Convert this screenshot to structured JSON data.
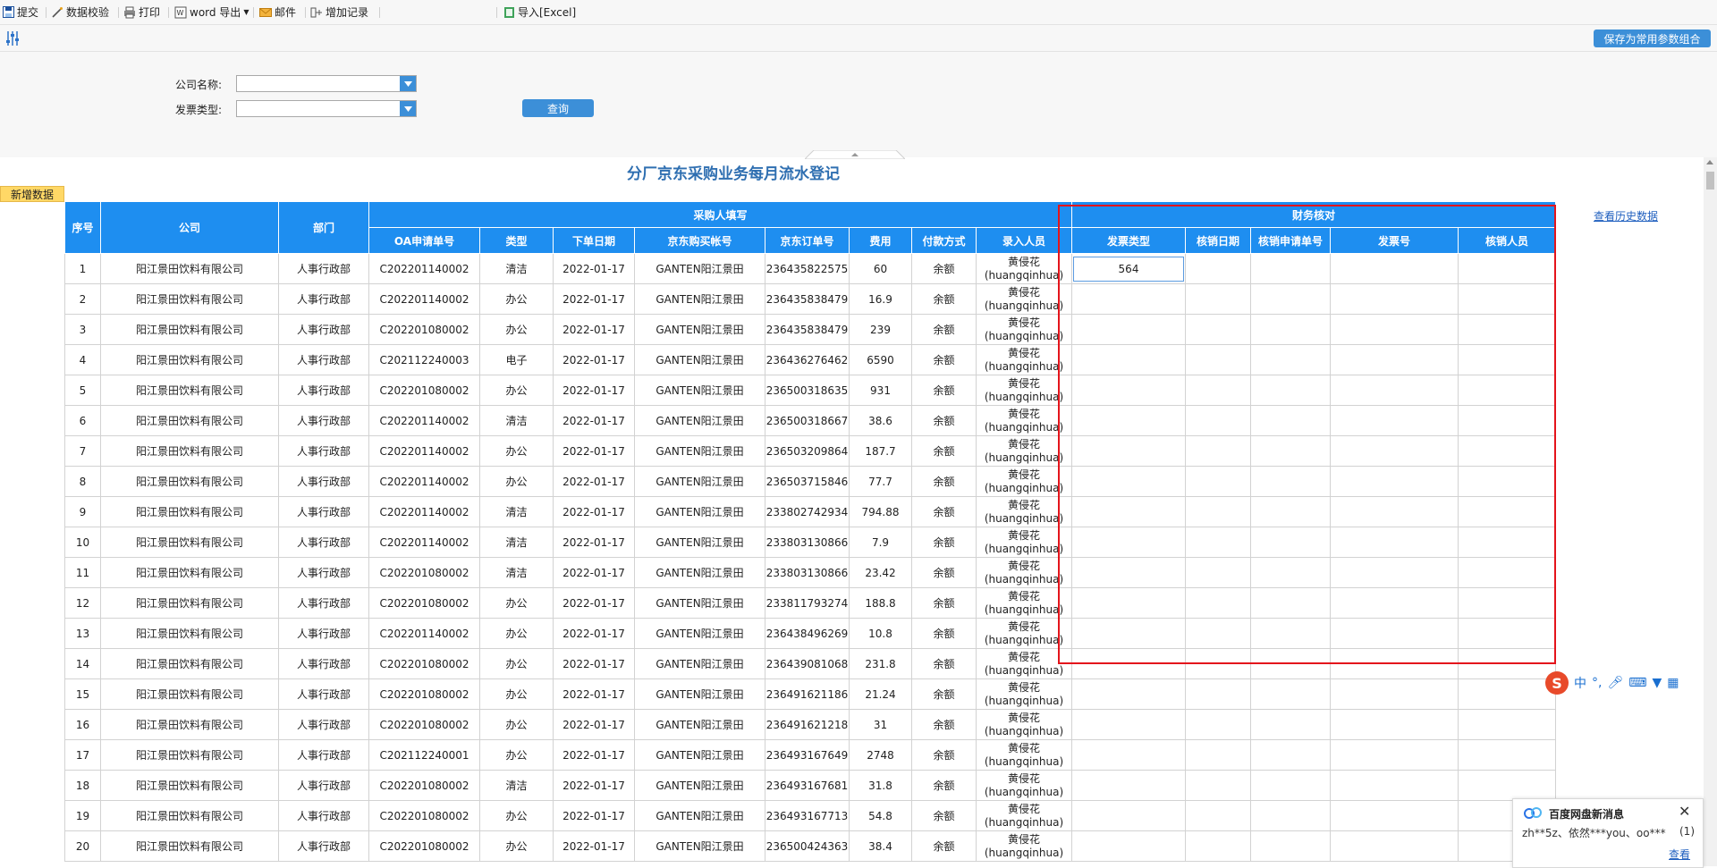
{
  "toolbar": {
    "submit": "提交",
    "validate": "数据校验",
    "print": "打印",
    "word_export": "word 导出",
    "mail": "邮件",
    "add_record": "增加记录",
    "import_excel": "导入[Excel]"
  },
  "params": {
    "save_combo": "保存为常用参数组合",
    "company_label": "公司名称:",
    "company_value": "",
    "invoice_label": "发票类型:",
    "invoice_value": "",
    "query_button": "查询"
  },
  "report": {
    "title": "分厂京东采购业务每月流水登记",
    "add_button": "新增数据",
    "history_link": "查看历史数据"
  },
  "table": {
    "group_headers": {
      "purchaser": "采购人填写",
      "finance": "财务核对"
    },
    "headers": {
      "seq": "序号",
      "company": "公司",
      "dept": "部门",
      "oa": "OA申请单号",
      "type": "类型",
      "date": "下单日期",
      "account": "京东购买帐号",
      "order": "京东订单号",
      "fee": "费用",
      "pay": "付款方式",
      "entry": "录入人员",
      "inv_type": "发票类型",
      "wo_date": "核销日期",
      "wo_no": "核销申请单号",
      "inv_no": "发票号",
      "wo_person": "核销人员"
    },
    "rows": [
      {
        "seq": "1",
        "company": "阳江景田饮料有限公司",
        "dept": "人事行政部",
        "oa": "C202201140002",
        "type": "清洁",
        "date": "2022-01-17",
        "account": "GANTEN阳江景田",
        "order": "236435822575",
        "fee": "60",
        "pay": "余额",
        "entry": "黄侵花(huangqinhua)",
        "inv_type": "564"
      },
      {
        "seq": "2",
        "company": "阳江景田饮料有限公司",
        "dept": "人事行政部",
        "oa": "C202201140002",
        "type": "办公",
        "date": "2022-01-17",
        "account": "GANTEN阳江景田",
        "order": "236435838479",
        "fee": "16.9",
        "pay": "余额",
        "entry": "黄侵花(huangqinhua)",
        "inv_type": ""
      },
      {
        "seq": "3",
        "company": "阳江景田饮料有限公司",
        "dept": "人事行政部",
        "oa": "C202201080002",
        "type": "办公",
        "date": "2022-01-17",
        "account": "GANTEN阳江景田",
        "order": "236435838479",
        "fee": "239",
        "pay": "余额",
        "entry": "黄侵花(huangqinhua)",
        "inv_type": ""
      },
      {
        "seq": "4",
        "company": "阳江景田饮料有限公司",
        "dept": "人事行政部",
        "oa": "C202112240003",
        "type": "电子",
        "date": "2022-01-17",
        "account": "GANTEN阳江景田",
        "order": "236436276462",
        "fee": "6590",
        "pay": "余额",
        "entry": "黄侵花(huangqinhua)",
        "inv_type": ""
      },
      {
        "seq": "5",
        "company": "阳江景田饮料有限公司",
        "dept": "人事行政部",
        "oa": "C202201080002",
        "type": "办公",
        "date": "2022-01-17",
        "account": "GANTEN阳江景田",
        "order": "236500318635",
        "fee": "931",
        "pay": "余额",
        "entry": "黄侵花(huangqinhua)",
        "inv_type": ""
      },
      {
        "seq": "6",
        "company": "阳江景田饮料有限公司",
        "dept": "人事行政部",
        "oa": "C202201140002",
        "type": "清洁",
        "date": "2022-01-17",
        "account": "GANTEN阳江景田",
        "order": "236500318667",
        "fee": "38.6",
        "pay": "余额",
        "entry": "黄侵花(huangqinhua)",
        "inv_type": ""
      },
      {
        "seq": "7",
        "company": "阳江景田饮料有限公司",
        "dept": "人事行政部",
        "oa": "C202201140002",
        "type": "办公",
        "date": "2022-01-17",
        "account": "GANTEN阳江景田",
        "order": "236503209864",
        "fee": "187.7",
        "pay": "余额",
        "entry": "黄侵花(huangqinhua)",
        "inv_type": ""
      },
      {
        "seq": "8",
        "company": "阳江景田饮料有限公司",
        "dept": "人事行政部",
        "oa": "C202201140002",
        "type": "办公",
        "date": "2022-01-17",
        "account": "GANTEN阳江景田",
        "order": "236503715846",
        "fee": "77.7",
        "pay": "余额",
        "entry": "黄侵花(huangqinhua)",
        "inv_type": ""
      },
      {
        "seq": "9",
        "company": "阳江景田饮料有限公司",
        "dept": "人事行政部",
        "oa": "C202201140002",
        "type": "清洁",
        "date": "2022-01-17",
        "account": "GANTEN阳江景田",
        "order": "233802742934",
        "fee": "794.88",
        "pay": "余额",
        "entry": "黄侵花(huangqinhua)",
        "inv_type": ""
      },
      {
        "seq": "10",
        "company": "阳江景田饮料有限公司",
        "dept": "人事行政部",
        "oa": "C202201140002",
        "type": "清洁",
        "date": "2022-01-17",
        "account": "GANTEN阳江景田",
        "order": "233803130866",
        "fee": "7.9",
        "pay": "余额",
        "entry": "黄侵花(huangqinhua)",
        "inv_type": ""
      },
      {
        "seq": "11",
        "company": "阳江景田饮料有限公司",
        "dept": "人事行政部",
        "oa": "C202201080002",
        "type": "清洁",
        "date": "2022-01-17",
        "account": "GANTEN阳江景田",
        "order": "233803130866",
        "fee": "23.42",
        "pay": "余额",
        "entry": "黄侵花(huangqinhua)",
        "inv_type": ""
      },
      {
        "seq": "12",
        "company": "阳江景田饮料有限公司",
        "dept": "人事行政部",
        "oa": "C202201080002",
        "type": "办公",
        "date": "2022-01-17",
        "account": "GANTEN阳江景田",
        "order": "233811793274",
        "fee": "188.8",
        "pay": "余额",
        "entry": "黄侵花(huangqinhua)",
        "inv_type": ""
      },
      {
        "seq": "13",
        "company": "阳江景田饮料有限公司",
        "dept": "人事行政部",
        "oa": "C202201140002",
        "type": "办公",
        "date": "2022-01-17",
        "account": "GANTEN阳江景田",
        "order": "236438496269",
        "fee": "10.8",
        "pay": "余额",
        "entry": "黄侵花(huangqinhua)",
        "inv_type": ""
      },
      {
        "seq": "14",
        "company": "阳江景田饮料有限公司",
        "dept": "人事行政部",
        "oa": "C202201080002",
        "type": "办公",
        "date": "2022-01-17",
        "account": "GANTEN阳江景田",
        "order": "236439081068",
        "fee": "231.8",
        "pay": "余额",
        "entry": "黄侵花(huangqinhua)",
        "inv_type": ""
      },
      {
        "seq": "15",
        "company": "阳江景田饮料有限公司",
        "dept": "人事行政部",
        "oa": "C202201080002",
        "type": "办公",
        "date": "2022-01-17",
        "account": "GANTEN阳江景田",
        "order": "236491621186",
        "fee": "21.24",
        "pay": "余额",
        "entry": "黄侵花(huangqinhua)",
        "inv_type": ""
      },
      {
        "seq": "16",
        "company": "阳江景田饮料有限公司",
        "dept": "人事行政部",
        "oa": "C202201080002",
        "type": "办公",
        "date": "2022-01-17",
        "account": "GANTEN阳江景田",
        "order": "236491621218",
        "fee": "31",
        "pay": "余额",
        "entry": "黄侵花(huangqinhua)",
        "inv_type": ""
      },
      {
        "seq": "17",
        "company": "阳江景田饮料有限公司",
        "dept": "人事行政部",
        "oa": "C202112240001",
        "type": "办公",
        "date": "2022-01-17",
        "account": "GANTEN阳江景田",
        "order": "236493167649",
        "fee": "2748",
        "pay": "余额",
        "entry": "黄侵花(huangqinhua)",
        "inv_type": ""
      },
      {
        "seq": "18",
        "company": "阳江景田饮料有限公司",
        "dept": "人事行政部",
        "oa": "C202201080002",
        "type": "清洁",
        "date": "2022-01-17",
        "account": "GANTEN阳江景田",
        "order": "236493167681",
        "fee": "31.8",
        "pay": "余额",
        "entry": "黄侵花(huangqinhua)",
        "inv_type": ""
      },
      {
        "seq": "19",
        "company": "阳江景田饮料有限公司",
        "dept": "人事行政部",
        "oa": "C202201080002",
        "type": "办公",
        "date": "2022-01-17",
        "account": "GANTEN阳江景田",
        "order": "236493167713",
        "fee": "54.8",
        "pay": "余额",
        "entry": "黄侵花(huangqinhua)",
        "inv_type": ""
      },
      {
        "seq": "20",
        "company": "阳江景田饮料有限公司",
        "dept": "人事行政部",
        "oa": "C202201080002",
        "type": "办公",
        "date": "2022-01-17",
        "account": "GANTEN阳江景田",
        "order": "236500424363",
        "fee": "38.4",
        "pay": "余额",
        "entry": "黄侵花(huangqinhua)",
        "inv_type": ""
      }
    ]
  },
  "ime": {
    "logo": "S",
    "mode": "中",
    "punct": "°,"
  },
  "popup": {
    "title": "百度网盘新消息",
    "message": "zh**5z、依然***you、oo***",
    "count": "(1)",
    "view": "查看"
  },
  "colors": {
    "header_blue": "#1e8ef0",
    "button_blue": "#3c8fd8",
    "highlight_red": "#e4141b",
    "add_yellow": "#ffd866"
  }
}
